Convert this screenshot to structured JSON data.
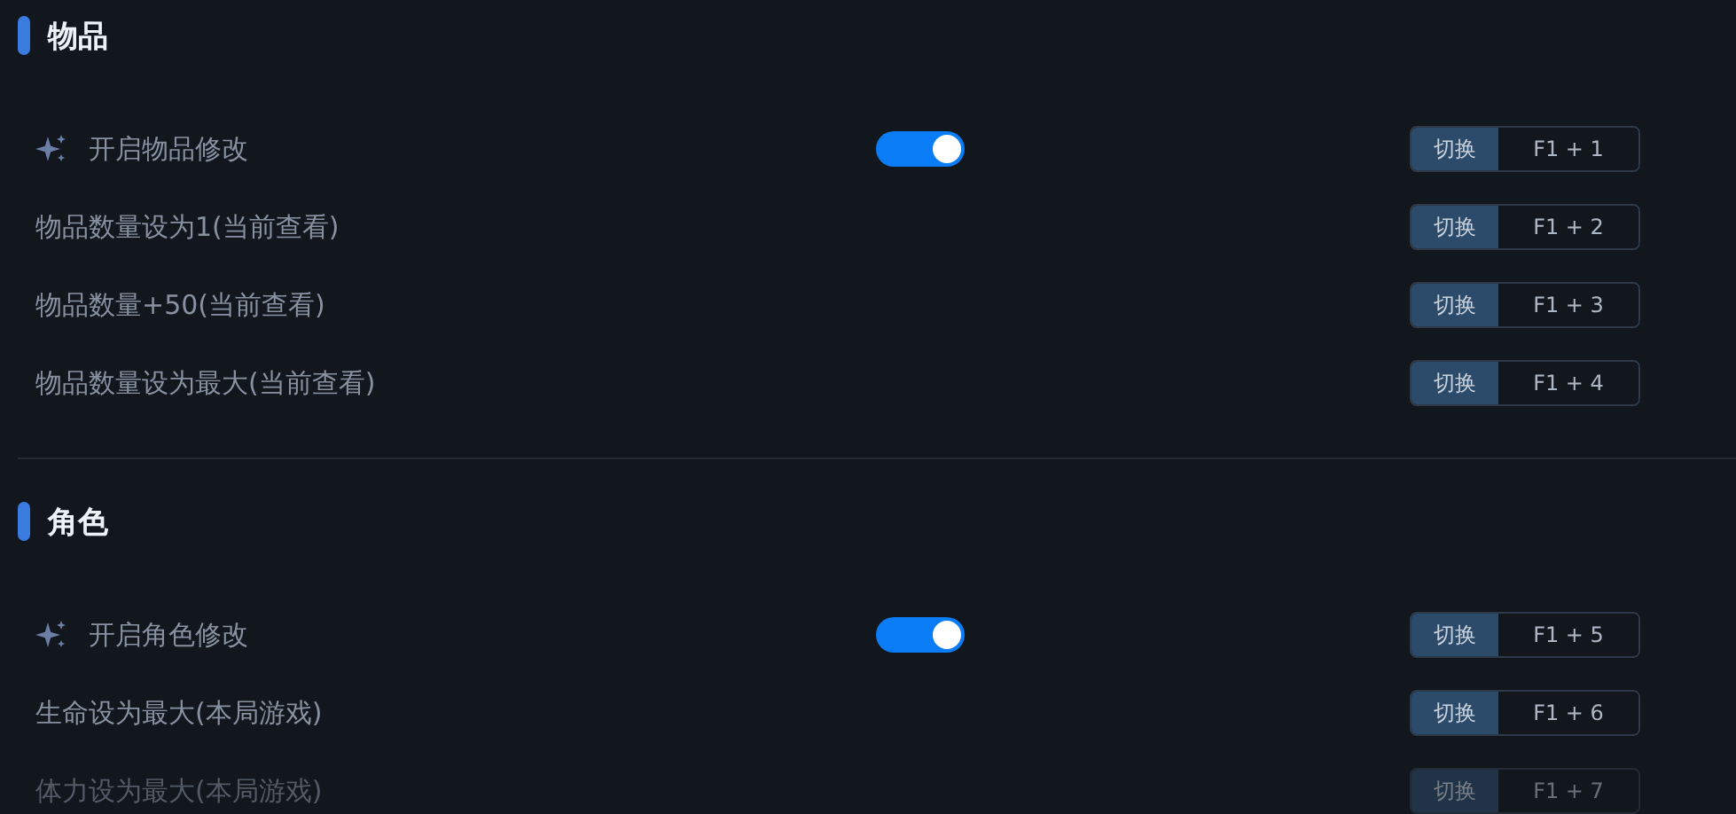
{
  "sections": [
    {
      "title": "物品",
      "rows": [
        {
          "kind": "toggle",
          "label": "开启物品修改",
          "on": true,
          "disabled": false,
          "action": "切换",
          "hotkey": "F1 + 1"
        },
        {
          "kind": "action",
          "label": "物品数量设为1(当前查看)",
          "disabled": false,
          "action": "切换",
          "hotkey": "F1 + 2"
        },
        {
          "kind": "action",
          "label": "物品数量+50(当前查看)",
          "disabled": false,
          "action": "切换",
          "hotkey": "F1 + 3"
        },
        {
          "kind": "action",
          "label": "物品数量设为最大(当前查看)",
          "disabled": false,
          "action": "切换",
          "hotkey": "F1 + 4"
        }
      ]
    },
    {
      "title": "角色",
      "rows": [
        {
          "kind": "toggle",
          "label": "开启角色修改",
          "on": true,
          "disabled": false,
          "action": "切换",
          "hotkey": "F1 + 5"
        },
        {
          "kind": "action",
          "label": "生命设为最大(本局游戏)",
          "disabled": false,
          "action": "切换",
          "hotkey": "F1 + 6"
        },
        {
          "kind": "action",
          "label": "体力设为最大(本局游戏)",
          "disabled": true,
          "action": "切换",
          "hotkey": "F1 + 7"
        }
      ]
    }
  ]
}
